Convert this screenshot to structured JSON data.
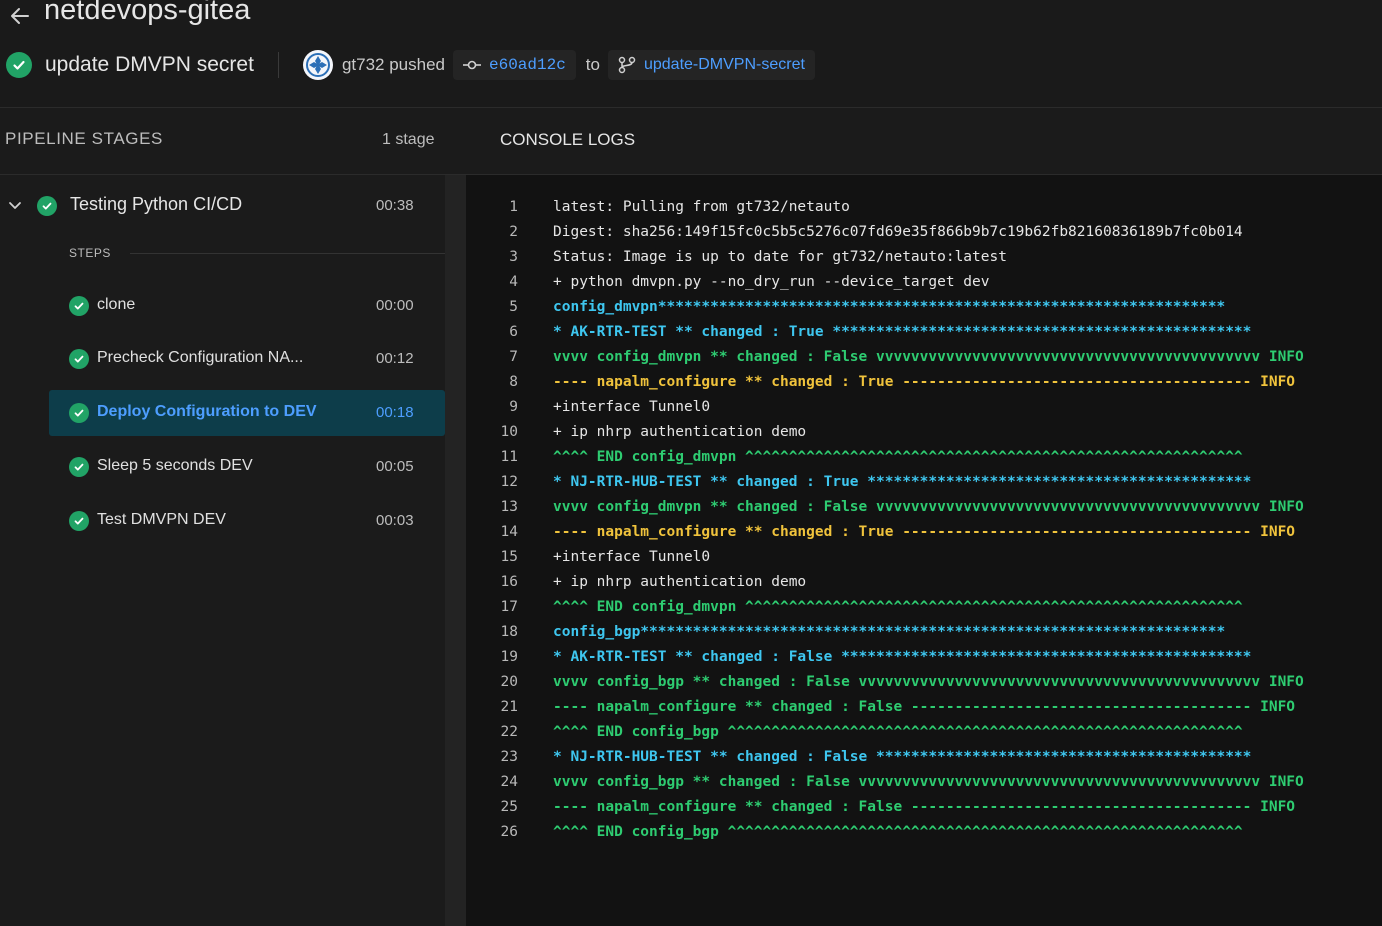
{
  "header": {
    "repo_name": "netdevops-gitea",
    "run_title": "update DMVPN secret",
    "pusher": "gt732 pushed",
    "commit": "e60ad12c",
    "to_label": "to",
    "branch": "update-DMVPN-secret"
  },
  "pipeline": {
    "title": "PIPELINE STAGES",
    "count": "1 stage",
    "stage": {
      "name": "Testing Python CI/CD",
      "time": "00:38"
    },
    "steps_label": "STEPS",
    "steps": [
      {
        "name": "clone",
        "time": "00:00"
      },
      {
        "name": "Precheck Configuration NA...",
        "time": "00:12"
      },
      {
        "name": "Deploy Configuration to DEV",
        "time": "00:18"
      },
      {
        "name": "Sleep 5 seconds DEV",
        "time": "00:05"
      },
      {
        "name": "Test DMVPN DEV",
        "time": "00:03"
      }
    ]
  },
  "console": {
    "title": "CONSOLE LOGS",
    "colors": {
      "white": "#e6e6e6",
      "cyan": "#3ec6ef",
      "green": "#2ecc71",
      "yellow": "#f0c33c"
    },
    "lines": [
      {
        "n": "1",
        "text": "latest: Pulling from gt732/netauto",
        "color": "white"
      },
      {
        "n": "2",
        "text": "Digest: sha256:149f15fc0c5b5c5276c07fd69e35f866b9b7c19b62fb82160836189b7fc0b014",
        "color": "white"
      },
      {
        "n": "3",
        "text": "Status: Image is up to date for gt732/netauto:latest",
        "color": "white"
      },
      {
        "n": "4",
        "text": "+ python dmvpn.py --no_dry_run --device_target dev",
        "color": "white"
      },
      {
        "n": "5",
        "text": "config_dmvpn*****************************************************************",
        "color": "cyan"
      },
      {
        "n": "6",
        "text": "* AK-RTR-TEST ** changed : True ************************************************",
        "color": "cyan"
      },
      {
        "n": "7",
        "text": "vvvv config_dmvpn ** changed : False vvvvvvvvvvvvvvvvvvvvvvvvvvvvvvvvvvvvvvvvvvvv INFO",
        "color": "green"
      },
      {
        "n": "8",
        "text": "---- napalm_configure ** changed : True ---------------------------------------- INFO",
        "color": "yellow"
      },
      {
        "n": "9",
        "text": "+interface Tunnel0",
        "color": "white"
      },
      {
        "n": "10",
        "text": "+ ip nhrp authentication demo",
        "color": "white"
      },
      {
        "n": "11",
        "text": "^^^^ END config_dmvpn ^^^^^^^^^^^^^^^^^^^^^^^^^^^^^^^^^^^^^^^^^^^^^^^^^^^^^^^^^",
        "color": "green"
      },
      {
        "n": "12",
        "text": "* NJ-RTR-HUB-TEST ** changed : True ********************************************",
        "color": "cyan"
      },
      {
        "n": "13",
        "text": "vvvv config_dmvpn ** changed : False vvvvvvvvvvvvvvvvvvvvvvvvvvvvvvvvvvvvvvvvvvvv INFO",
        "color": "green"
      },
      {
        "n": "14",
        "text": "---- napalm_configure ** changed : True ---------------------------------------- INFO",
        "color": "yellow"
      },
      {
        "n": "15",
        "text": "+interface Tunnel0",
        "color": "white"
      },
      {
        "n": "16",
        "text": "+ ip nhrp authentication demo",
        "color": "white"
      },
      {
        "n": "17",
        "text": "^^^^ END config_dmvpn ^^^^^^^^^^^^^^^^^^^^^^^^^^^^^^^^^^^^^^^^^^^^^^^^^^^^^^^^^",
        "color": "green"
      },
      {
        "n": "18",
        "text": "config_bgp*******************************************************************",
        "color": "cyan"
      },
      {
        "n": "19",
        "text": "* AK-RTR-TEST ** changed : False ***********************************************",
        "color": "cyan"
      },
      {
        "n": "20",
        "text": "vvvv config_bgp ** changed : False vvvvvvvvvvvvvvvvvvvvvvvvvvvvvvvvvvvvvvvvvvvvvv INFO",
        "color": "green"
      },
      {
        "n": "21",
        "text": "---- napalm_configure ** changed : False --------------------------------------- INFO",
        "color": "green"
      },
      {
        "n": "22",
        "text": "^^^^ END config_bgp ^^^^^^^^^^^^^^^^^^^^^^^^^^^^^^^^^^^^^^^^^^^^^^^^^^^^^^^^^^^",
        "color": "green"
      },
      {
        "n": "23",
        "text": "* NJ-RTR-HUB-TEST ** changed : False *******************************************",
        "color": "cyan"
      },
      {
        "n": "24",
        "text": "vvvv config_bgp ** changed : False vvvvvvvvvvvvvvvvvvvvvvvvvvvvvvvvvvvvvvvvvvvvvv INFO",
        "color": "green"
      },
      {
        "n": "25",
        "text": "---- napalm_configure ** changed : False --------------------------------------- INFO",
        "color": "green"
      },
      {
        "n": "26",
        "text": "^^^^ END config_bgp ^^^^^^^^^^^^^^^^^^^^^^^^^^^^^^^^^^^^^^^^^^^^^^^^^^^^^^^^^^^",
        "color": "green"
      }
    ]
  }
}
